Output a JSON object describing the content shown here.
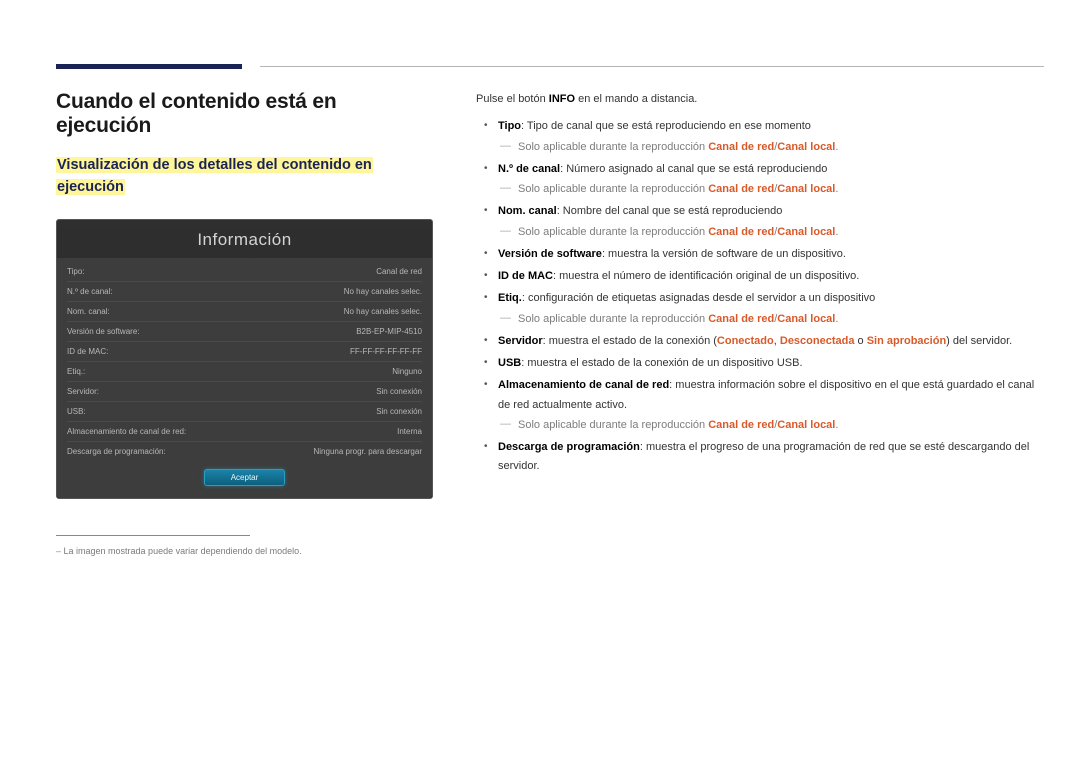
{
  "heading": "Cuando el contenido está en ejecución",
  "subheading_line1": "Visualización de los detalles del contenido en",
  "subheading_line2": "ejecución",
  "panel": {
    "title": "Información",
    "rows": [
      {
        "label": "Tipo:",
        "value": "Canal de red"
      },
      {
        "label": "N.º de canal:",
        "value": "No hay canales selec."
      },
      {
        "label": "Nom. canal:",
        "value": "No hay canales selec."
      },
      {
        "label": "Versión de software:",
        "value": "B2B-EP-MIP-4510"
      },
      {
        "label": "ID de MAC:",
        "value": "FF-FF-FF-FF-FF-FF"
      },
      {
        "label": "Etiq.:",
        "value": "Ninguno"
      },
      {
        "label": "Servidor:",
        "value": "Sin conexión"
      },
      {
        "label": "USB:",
        "value": "Sin conexión"
      },
      {
        "label": "Almacenamiento de canal de red:",
        "value": "Interna"
      },
      {
        "label": "Descarga de programación:",
        "value": "Ninguna progr. para descargar"
      }
    ],
    "button": "Aceptar"
  },
  "footnote": "La imagen mostrada puede variar dependiendo del modelo.",
  "instruction_pre": "Pulse el botón ",
  "instruction_bold": "INFO",
  "instruction_post": " en el mando a distancia.",
  "note_prefix": "Solo aplicable durante la reproducción ",
  "note_link": "Canal de red",
  "note_slash": "/",
  "note_link2": "Canal local",
  "note_dot": ".",
  "items": [
    {
      "term": "Tipo",
      "desc": ": Tipo de canal que se está reproduciendo en ese momento",
      "note": true
    },
    {
      "term": "N.º de canal",
      "desc": ": Número asignado al canal que se está reproduciendo",
      "note": true
    },
    {
      "term": "Nom. canal",
      "desc": ": Nombre del canal que se está reproduciendo",
      "note": true
    },
    {
      "term": "Versión de software",
      "desc": ": muestra la versión de software de un dispositivo.",
      "note": false
    },
    {
      "term": "ID de MAC",
      "desc": ": muestra el número de identificación original de un dispositivo.",
      "note": false
    },
    {
      "term": "Etiq.",
      "desc": ": configuración de etiquetas asignadas desde el servidor a un dispositivo",
      "note": true
    },
    {
      "term": "Servidor",
      "desc_pre": ": muestra el estado de la conexión (",
      "s1": "Conectado",
      "c1": ", ",
      "s2": "Desconectada",
      "c2": " o ",
      "s3": "Sin aprobación",
      "desc_post": ") del servidor.",
      "note": false,
      "servidor": true
    },
    {
      "term": "USB",
      "desc": ": muestra el estado de la conexión de un dispositivo USB.",
      "note": false
    },
    {
      "term": "Almacenamiento de canal de red",
      "desc": ": muestra información sobre el dispositivo en el que está guardado el canal de red actualmente activo.",
      "note": true
    },
    {
      "term": "Descarga de programación",
      "desc": ": muestra el progreso de una programación de red que se esté descargando del servidor.",
      "note": false
    }
  ]
}
